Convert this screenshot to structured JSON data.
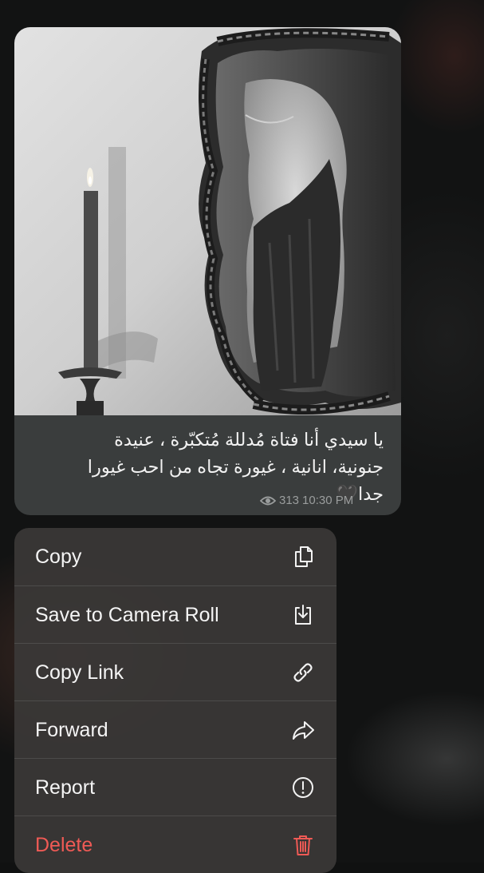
{
  "message": {
    "caption_lines": [
      "يا سيدي أنا فتاة مُدللة مُتكبّرة ، عنيدة",
      "جنونية،  انانية ، غيورة تجاه من احب غيورا",
      "جدا🖤"
    ],
    "views": "313",
    "time": "10:30 PM",
    "photo_icon": "photo-woman-mirror-candle"
  },
  "menu": {
    "items": [
      {
        "label": "Copy",
        "icon": "copy-icon"
      },
      {
        "label": "Save to Camera Roll",
        "icon": "save-download-icon"
      },
      {
        "label": "Copy Link",
        "icon": "link-icon"
      },
      {
        "label": "Forward",
        "icon": "forward-arrow-icon"
      },
      {
        "label": "Report",
        "icon": "exclamation-circle-icon"
      },
      {
        "label": "Delete",
        "icon": "trash-icon"
      }
    ]
  },
  "colors": {
    "bubble": "#3a3d3d",
    "menu": "#3a3837",
    "text": "#f4f4f4",
    "meta": "#9a9d9d",
    "danger": "#ef5a55"
  }
}
